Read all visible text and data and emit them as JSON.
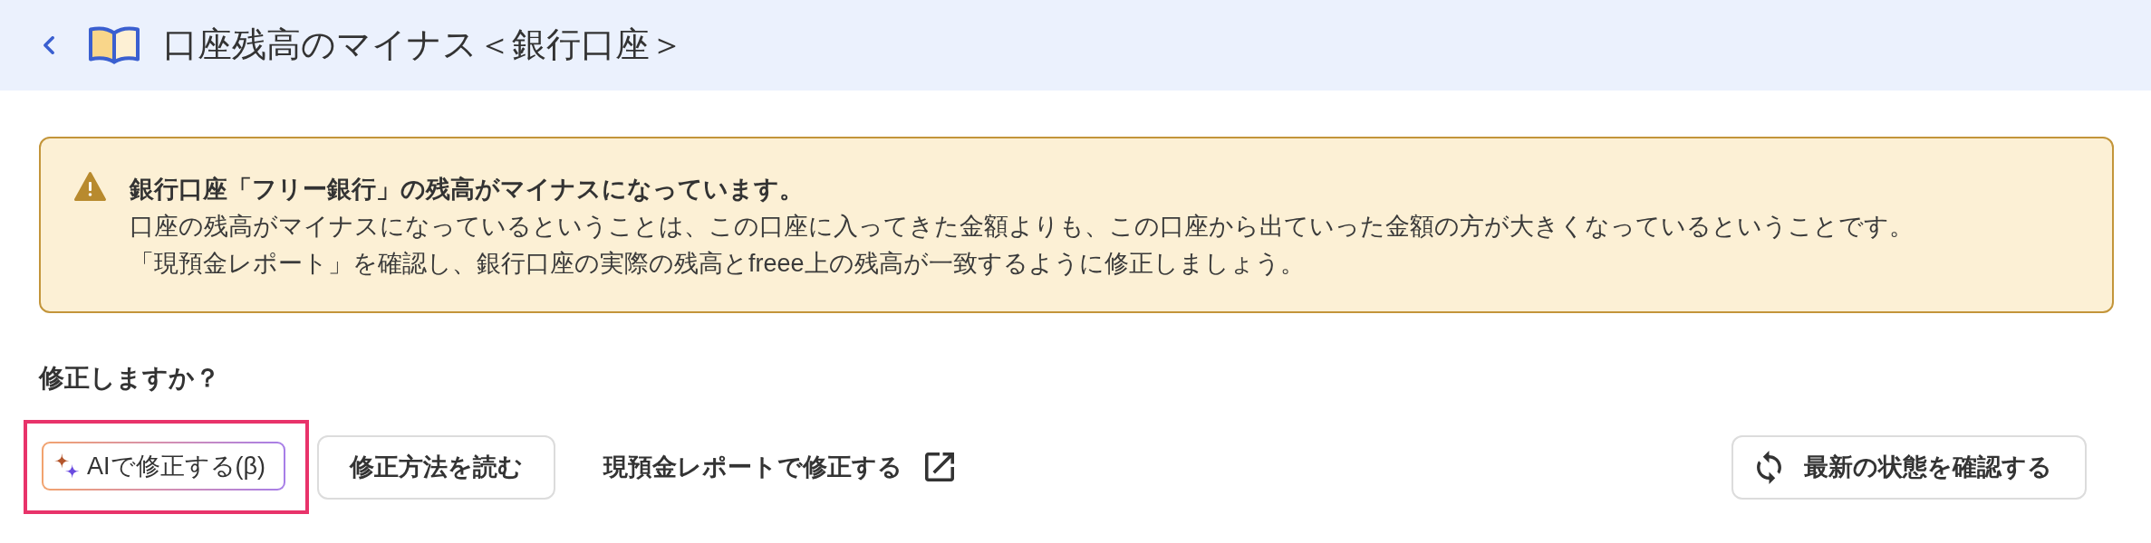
{
  "header": {
    "title": "口座残高のマイナス＜銀行口座＞"
  },
  "alert": {
    "kind": "warning",
    "title": "銀行口座「フリー銀行」の残高がマイナスになっています。",
    "lines": [
      "口座の残高がマイナスになっているということは、この口座に入ってきた金額よりも、この口座から出ていった金額の方が大きくなっているということです。",
      "「現預金レポート」を確認し、銀行口座の実際の残高とfreee上の残高が一致するように修正しましょう。"
    ]
  },
  "section": {
    "heading": "修正しますか？"
  },
  "actions": [
    {
      "kind": "ai_button",
      "label": "AIで修正する(β)",
      "highlighted": true
    },
    {
      "kind": "button",
      "label": "修正方法を読む",
      "highlighted": false
    },
    {
      "kind": "external_link",
      "label": "現預金レポートで修正する",
      "highlighted": false
    }
  ],
  "refresh_button": {
    "label": "最新の状態を確認する"
  }
}
